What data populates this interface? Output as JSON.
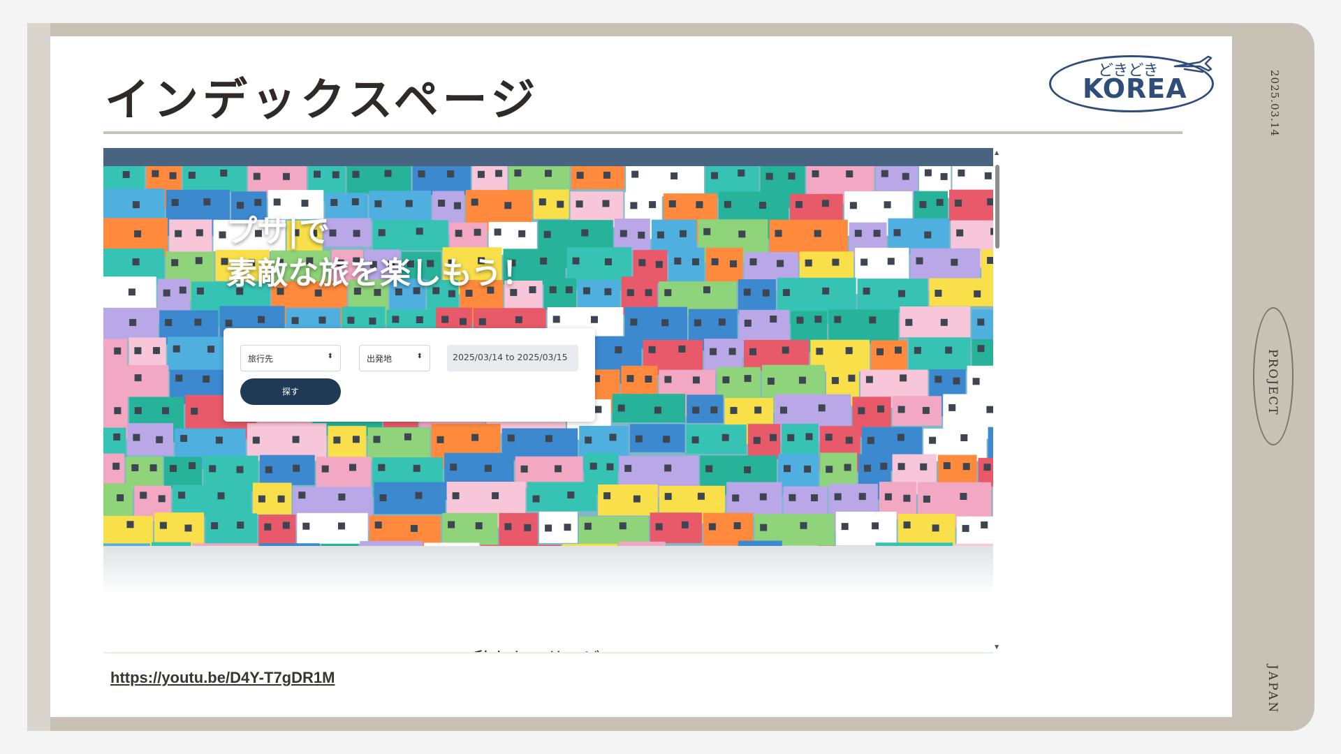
{
  "slide": {
    "title": "インデックスページ",
    "date": "2025.03.14",
    "side_label": "PROJECT",
    "bottom_side_label": "JAPAN",
    "video_link": "https://youtu.be/D4Y-T7gDR1M"
  },
  "logo": {
    "top_text": "どきどき",
    "main_text": "KOREA",
    "icon": "airplane-icon",
    "color": "#2e4d78"
  },
  "website": {
    "hero_title_line1": "プサ|で",
    "hero_title_line2": "素敵な旅を楽しもう！",
    "search": {
      "destination_value": "旅行先",
      "departure_value": "出発地",
      "date_range": "2025/03/14 to 2025/03/15",
      "search_button": "探す"
    },
    "section_heading": "私たちのサービス",
    "nav_color": "#496481",
    "button_color": "#1f3a55"
  },
  "colors": {
    "frame": "#c7c1b6",
    "frame_light": "#d9d5cd",
    "title": "#2f2a26"
  }
}
